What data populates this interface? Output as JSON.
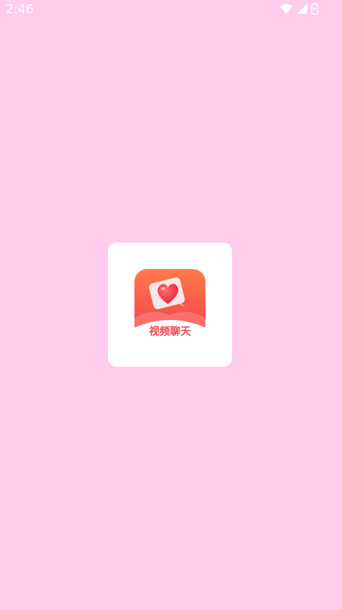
{
  "status_bar": {
    "time": "2:46",
    "icons": [
      "wifi-icon",
      "cellular-signal-icon",
      "battery-charging-icon"
    ]
  },
  "splash": {
    "app_name": "视频聊天",
    "logo_icon": "heart-chat-bubble-icon"
  },
  "colors": {
    "background": "#FFCCEC",
    "card": "#FFFFFF",
    "brand_red": "#F0454F",
    "brand_orange": "#FF7A4D"
  }
}
